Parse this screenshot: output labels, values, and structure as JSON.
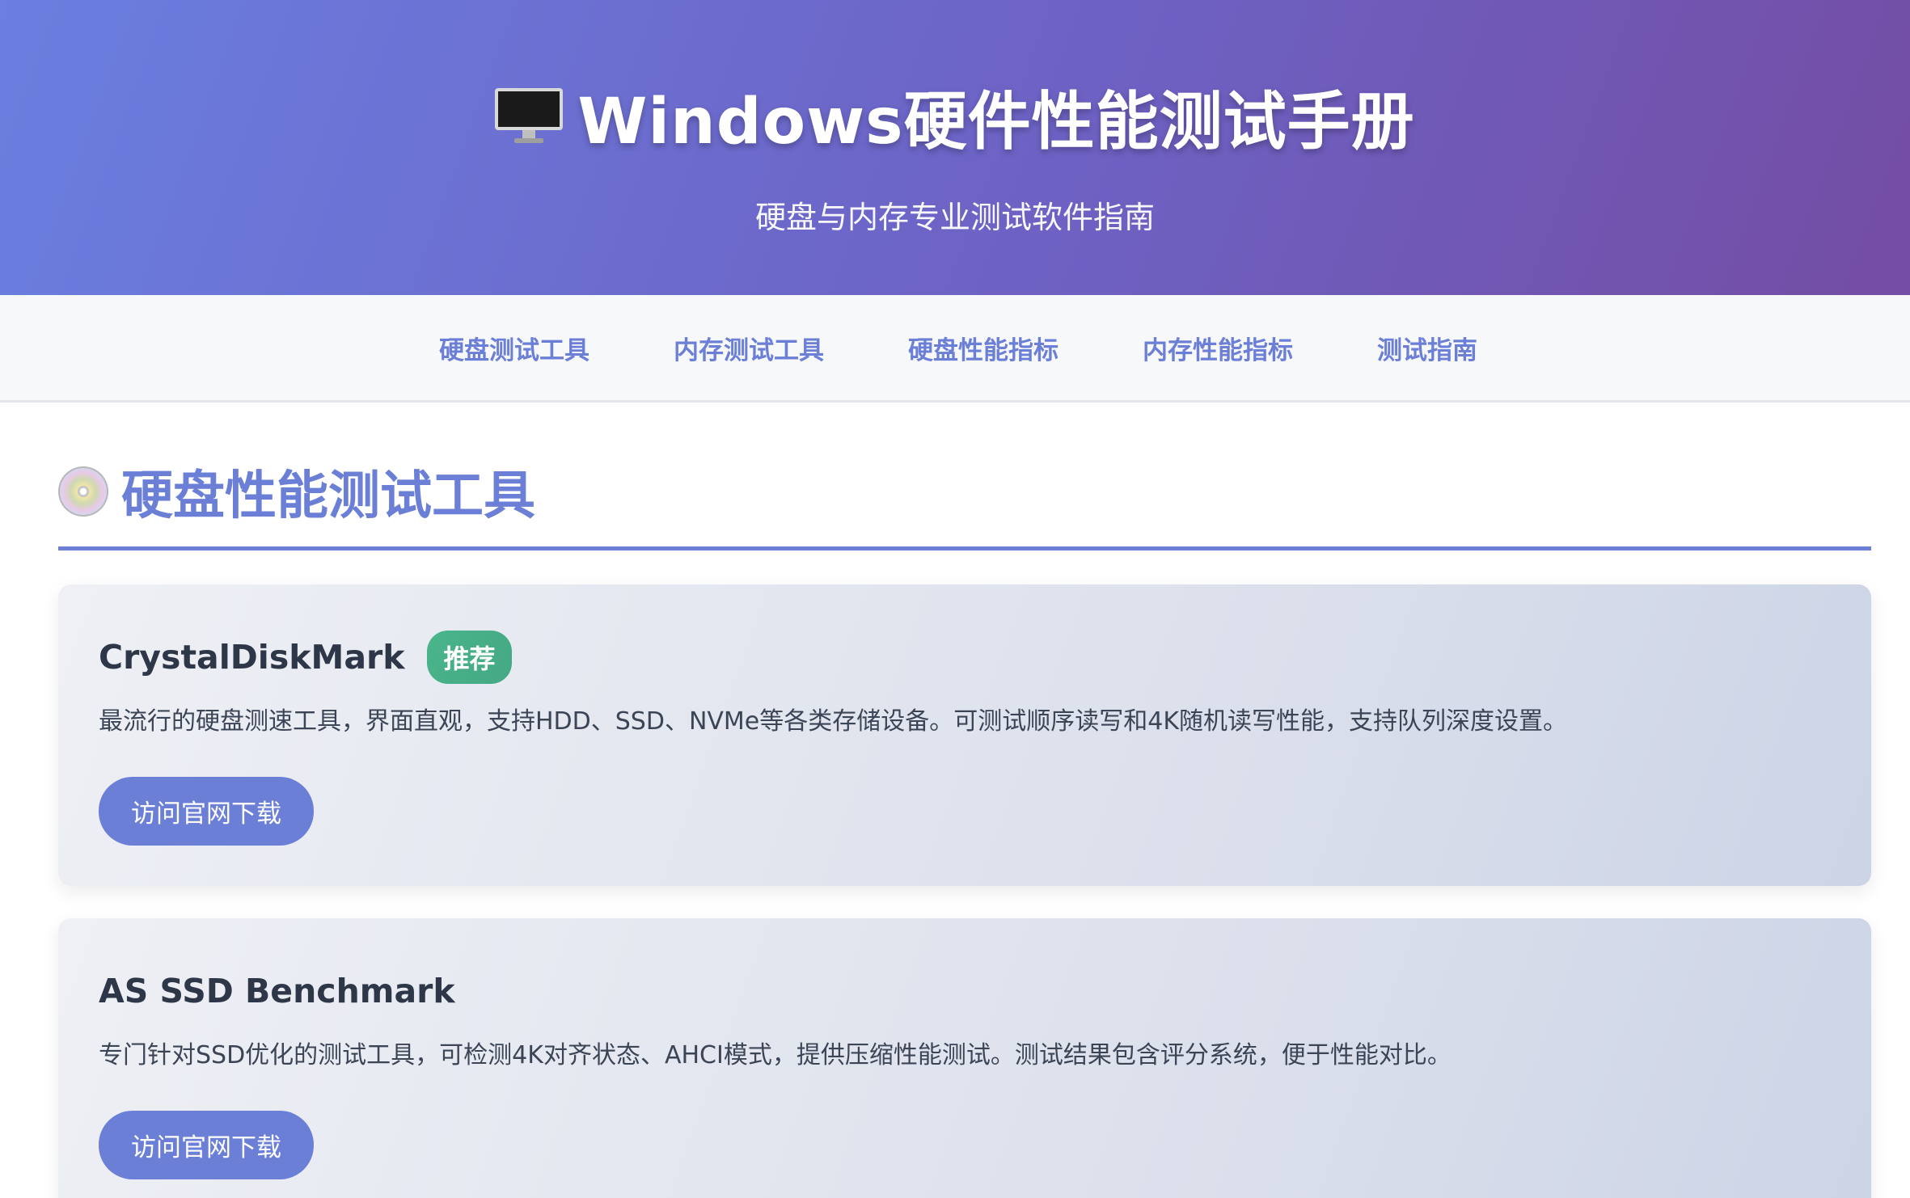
{
  "header": {
    "title": "Windows硬件性能测试手册",
    "subtitle": "硬盘与内存专业测试软件指南",
    "icon": "desktop-computer-icon"
  },
  "nav": {
    "items": [
      {
        "label": "硬盘测试工具"
      },
      {
        "label": "内存测试工具"
      },
      {
        "label": "硬盘性能指标"
      },
      {
        "label": "内存性能指标"
      },
      {
        "label": "测试指南"
      }
    ]
  },
  "section": {
    "title": "硬盘性能测试工具",
    "icon": "optical-disc-icon"
  },
  "cards": [
    {
      "title": "CrystalDiskMark",
      "badge": "推荐",
      "description": "最流行的硬盘测速工具，界面直观，支持HDD、SSD、NVMe等各类存储设备。可测试顺序读写和4K随机读写性能，支持队列深度设置。",
      "button": "访问官网下载"
    },
    {
      "title": "AS SSD Benchmark",
      "description": "专门针对SSD优化的测试工具，可检测4K对齐状态、AHCI模式，提供压缩性能测试。测试结果包含评分系统，便于性能对比。",
      "button": "访问官网下载"
    }
  ],
  "colors": {
    "accent": "#6b7fd7",
    "badge": "#48b388",
    "header_start": "#6a7fe0",
    "header_end": "#744da4"
  }
}
